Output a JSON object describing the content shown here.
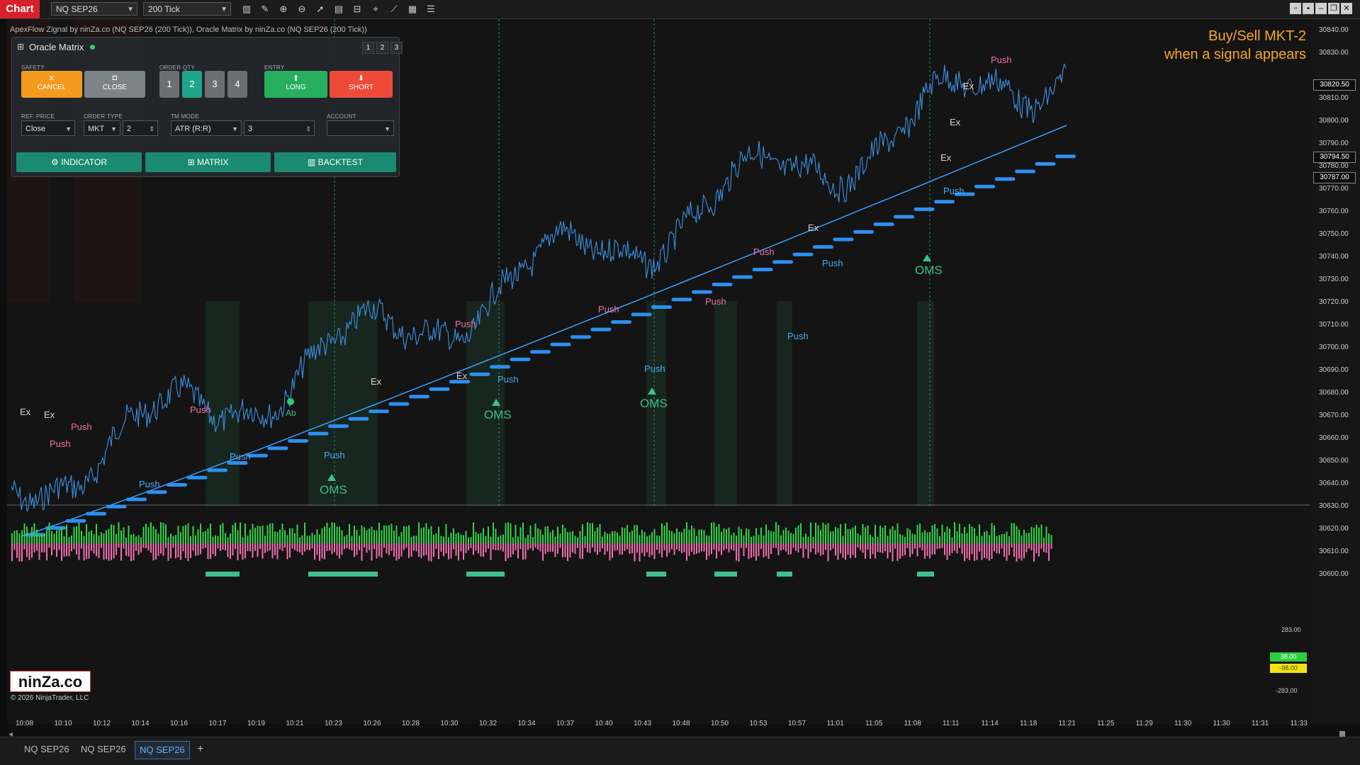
{
  "toolbar": {
    "chart_label": "Chart",
    "instrument": "NQ SEP26",
    "bar_type": "200 Tick",
    "tools": [
      "bar-chart-icon",
      "pencil-icon",
      "zoom-in-icon",
      "zoom-out-icon",
      "pointer-icon",
      "properties-icon",
      "drawing-icon",
      "crosshair-icon",
      "line-tool-icon",
      "strategy-icon",
      "list-icon"
    ]
  },
  "chart_info": "ApexFlow Zignal by ninZa.co (NQ SEP26 (200 Tick)), Oracle Matrix by ninZa.co (NQ SEP26 (200 Tick))",
  "signal_note": {
    "line1": "Buy/Sell MKT-2",
    "line2": "when a signal appears"
  },
  "panel": {
    "title": "Oracle Matrix",
    "pages": [
      "1",
      "2",
      "3"
    ],
    "safety_label": "SAFETY",
    "cancel": "CANCEL",
    "close": "CLOSE",
    "order_qty_label": "ORDER QTY",
    "qty_options": [
      "1",
      "2",
      "3",
      "4"
    ],
    "entry_label": "ENTRY",
    "long": "LONG",
    "short": "SHORT",
    "ref_price_label": "REF. PRICE",
    "ref_price": "Close",
    "order_type_label": "ORDER TYPE",
    "order_type": "MKT",
    "order_offset": "2",
    "tm_mode_label": "TM MODE",
    "tm_mode": "ATR (R:R)",
    "tm_value": "3",
    "account_label": "ACCOUNT",
    "account": "",
    "indicator_btn": "INDICATOR",
    "matrix_btn": "MATRIX",
    "backtest_btn": "BACKTEST"
  },
  "y_axis": {
    "labels": [
      "30840.00",
      "30830.00",
      "30810.00",
      "30800.00",
      "30790.00",
      "30780.00",
      "30770.00",
      "30760.00",
      "30750.00",
      "30740.00",
      "30730.00",
      "30720.00",
      "30710.00",
      "30700.00",
      "30690.00",
      "30680.00",
      "30670.00",
      "30660.00",
      "30650.00",
      "30640.00",
      "30630.00",
      "30620.00",
      "30610.00",
      "30600.00"
    ],
    "tags": [
      "30820.50",
      "30794.50",
      "30787.00"
    ]
  },
  "volume_axis": {
    "top": "283.00",
    "bottom": "-283.00",
    "tag_green": "38.00",
    "tag_yellow": "-98.00"
  },
  "x_axis": {
    "labels": [
      "10:08",
      "10:10",
      "10:12",
      "10:14",
      "10:16",
      "10:17",
      "10:19",
      "10:21",
      "10:23",
      "10:26",
      "10:28",
      "10:30",
      "10:32",
      "10:34",
      "10:37",
      "10:40",
      "10:43",
      "10:48",
      "10:50",
      "10:53",
      "10:57",
      "11:01",
      "11:05",
      "11:08",
      "11:11",
      "11:14",
      "11:18",
      "11:21",
      "11:25",
      "11:29",
      "11:30",
      "11:30",
      "11:31",
      "11:33"
    ]
  },
  "annotations": {
    "oms_label": "OMS",
    "push_label": "Push",
    "ex_label": "Ex",
    "ab_label": "Ab"
  },
  "tabs": [
    "NQ SEP26",
    "NQ SEP26",
    "NQ SEP26"
  ],
  "add_tab": "+",
  "logo_text": "ninZa.co",
  "copyright": "© 2026 NinjaTrader, LLC",
  "colors": {
    "price": "#3d8fe0",
    "trend": "#3aa0ff",
    "oms": "#3ec08a",
    "push_up": "#4aa9f0",
    "push_down": "#f06fa8",
    "chart_btn": "#d9202a",
    "panel_btn": "#1a8a72"
  }
}
